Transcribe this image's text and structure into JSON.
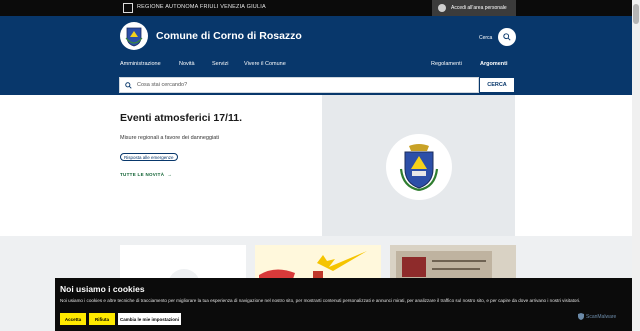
{
  "topbar": {
    "region_name": "REGIONE AUTONOMA FRIULI VENEZIA GIULIA",
    "login_label": "Accedi all'area personale",
    "login_icon": "user-icon"
  },
  "header": {
    "site_title": "Comune di Corno di Rosazzo",
    "search_label": "Cerca",
    "logo_icon": "municipal-crest-icon",
    "nav_left": [
      "Amministrazione",
      "Novità",
      "Servizi",
      "Vivere il Comune"
    ],
    "nav_right": [
      "Regolamenti",
      "Argomenti"
    ]
  },
  "search": {
    "placeholder": "Cosa stai cercando?",
    "button_label": "CERCA"
  },
  "hero": {
    "title": "Eventi atmosferici 17/11.",
    "subtitle": "Misure regionali a favore dei danneggiati",
    "tag": "Risposta alle emergenze",
    "link": "TUTTE LE NOVITÀ"
  },
  "cookie": {
    "title": "Noi usiamo i cookies",
    "text": "Noi usiamo i cookies e altre tecniche di tracciamento per migliorare la tua esperienza di navigazione nel nostro sito, per mostrarti contenuti personalizzati e annunci mirati, per analizzare il traffico sul nostro sito, e per capire da dove arrivano i nostri visitatori.",
    "accept": "Accetta",
    "reject": "Rifiuta",
    "settings": "Cambia le mie impostazioni",
    "brand": "ScanMalware"
  },
  "colors": {
    "primary": "#08376b",
    "topbar": "#0b0b0b",
    "cookie_button": "#ffea00",
    "link_green": "#0b5f2f"
  }
}
